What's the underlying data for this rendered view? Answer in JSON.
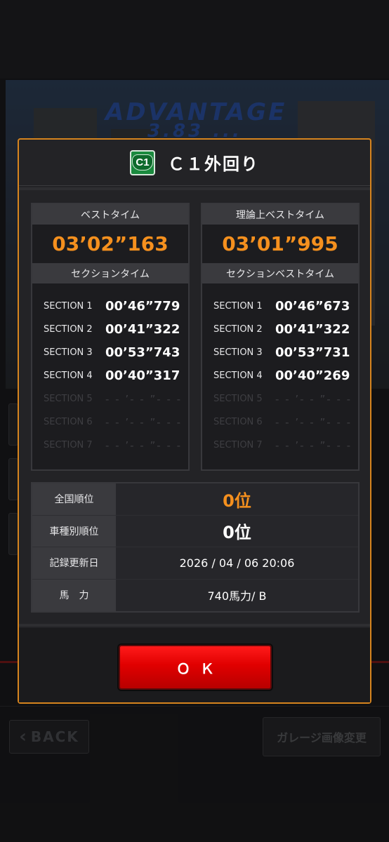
{
  "background": {
    "banner_line1": "ADVANTAGE",
    "banner_line2": "3.83 ...",
    "back_label": "BACK",
    "garage_label": "ガレージ画像変更"
  },
  "modal": {
    "badge": "C1",
    "title": "Ｃ１外回り",
    "best": {
      "header": "ベストタイム",
      "time": "03’02”163",
      "section_header": "セクションタイム",
      "sections": [
        {
          "label": "SECTION 1",
          "time": "00’46”779"
        },
        {
          "label": "SECTION 2",
          "time": "00’41”322"
        },
        {
          "label": "SECTION 3",
          "time": "00’53”743"
        },
        {
          "label": "SECTION 4",
          "time": "00’40”317"
        },
        {
          "label": "SECTION 5",
          "time": "- - ’- - ”- - -"
        },
        {
          "label": "SECTION 6",
          "time": "- - ’- - ”- - -"
        },
        {
          "label": "SECTION 7",
          "time": "- - ’- - ”- - -"
        }
      ]
    },
    "theory": {
      "header": "理論上ベストタイム",
      "time": "03’01”995",
      "section_header": "セクションベストタイム",
      "sections": [
        {
          "label": "SECTION 1",
          "time": "00’46”673"
        },
        {
          "label": "SECTION 2",
          "time": "00’41”322"
        },
        {
          "label": "SECTION 3",
          "time": "00’53”731"
        },
        {
          "label": "SECTION 4",
          "time": "00’40”269"
        },
        {
          "label": "SECTION 5",
          "time": "- - ’- - ”- - -"
        },
        {
          "label": "SECTION 6",
          "time": "- - ’- - ”- - -"
        },
        {
          "label": "SECTION 7",
          "time": "- - ’- - ”- - -"
        }
      ]
    },
    "info": [
      {
        "label": "全国順位",
        "value": "0位"
      },
      {
        "label": "車種別順位",
        "value": "0位"
      },
      {
        "label": "記録更新日",
        "value": "2026 / 04 / 06 20:06"
      },
      {
        "label": "馬　力",
        "value": "740馬力/ B"
      }
    ],
    "ok_label": "ＯＫ"
  },
  "colors": {
    "accent_orange": "#f5901e",
    "ok_red": "#e00000",
    "route_green": "#1a8a3e"
  }
}
